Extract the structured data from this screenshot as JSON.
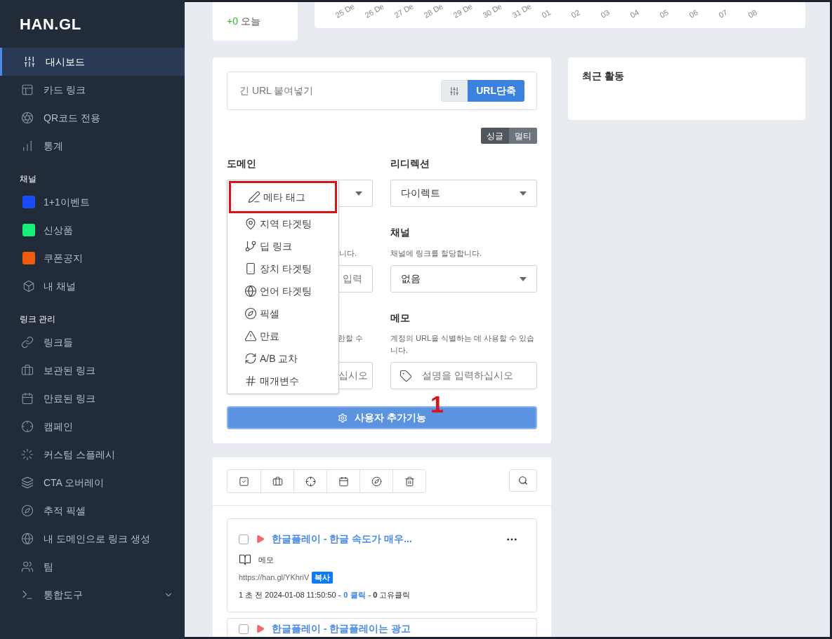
{
  "sidebar": {
    "logo": "HAN.GL",
    "main_items": [
      {
        "label": "대시보드",
        "selected": true
      },
      {
        "label": "카드 링크",
        "selected": false
      },
      {
        "label": "QR코드 전용",
        "selected": false
      },
      {
        "label": "통계",
        "selected": false
      }
    ],
    "channels_title": "채널",
    "channels": [
      {
        "label": "1+1이벤트",
        "kind": "color",
        "color": "#1a4dff"
      },
      {
        "label": "신상품",
        "kind": "color",
        "color": "#14f07a"
      },
      {
        "label": "쿠폰공지",
        "kind": "color",
        "color": "#f25a0f"
      },
      {
        "label": "내 채널",
        "kind": "icon"
      }
    ],
    "links_title": "링크 관리",
    "link_items": [
      {
        "label": "링크들",
        "kind": "plain"
      },
      {
        "label": "보관된 링크",
        "kind": "plain"
      },
      {
        "label": "만료된 링크",
        "kind": "plain"
      },
      {
        "label": "캠페인",
        "kind": "plain"
      },
      {
        "label": "커스텀 스플레시",
        "kind": "plain"
      },
      {
        "label": "CTA 오버레이",
        "kind": "plain"
      },
      {
        "label": "추적 픽셀",
        "kind": "plain"
      },
      {
        "label": "내 도메인으로 링크 생성",
        "kind": "plain"
      },
      {
        "label": "팀",
        "kind": "plain"
      },
      {
        "label": "통합도구",
        "kind": "group",
        "expanded": false
      }
    ]
  },
  "stats_card": {
    "delta": "+0",
    "label": "오늘"
  },
  "chart_axis_labels": [
    "25 De",
    "26 De",
    "27 De",
    "28 De",
    "29 De",
    "30 De",
    "31 De",
    "01",
    "02",
    "03",
    "04",
    "05",
    "06",
    "07",
    "08"
  ],
  "shortener": {
    "url_placeholder": "긴 URL 붙여넣기",
    "shorten_button": "URL단축",
    "modes": [
      {
        "label": "싱글",
        "selected": true
      },
      {
        "label": "멀티",
        "selected": false
      }
    ],
    "domain_label": "도메인",
    "domain_desc_fragment": "니다.",
    "domain_input_fragment": "입력",
    "limit_desc_fragment": "한할 수",
    "limit_input_fragment": "십시오",
    "redirect_label": "리디렉션",
    "redirect_value": "다이렉트",
    "channel_label": "채널",
    "channel_desc": "채널에 링크를 할당합니다.",
    "channel_value": "없음",
    "memo_label": "메모",
    "memo_desc": "계정의 URL을 식별하는 데 사용할 수 있습니다.",
    "memo_placeholder": "설명을 입력하십시오",
    "menu": [
      {
        "label": "메타 태그",
        "annotated": true
      },
      {
        "label": "지역 타겟팅",
        "annotated": false
      },
      {
        "label": "딥 링크",
        "annotated": false
      },
      {
        "label": "장치 타겟팅",
        "annotated": false
      },
      {
        "label": "언어 타겟팅",
        "annotated": false
      },
      {
        "label": "픽셀",
        "annotated": false
      },
      {
        "label": "만료",
        "annotated": false
      },
      {
        "label": "A/B 교차",
        "annotated": false
      },
      {
        "label": "매개변수",
        "annotated": false
      }
    ],
    "addon_button": "사용자 추가기능",
    "annotation_number": "1"
  },
  "recent_activity": {
    "title": "최근 활동"
  },
  "links": {
    "items": [
      {
        "title": "한글플레이 - 한글 속도가 매우...",
        "checked": false,
        "memo": "메모",
        "url": "https://han.gl/YKhriV",
        "copy": "복사",
        "time": "1 초 전 2024-01-08 11:50:50 -",
        "clicks": "0 클릭",
        "unique": "- **0** 고유클릭"
      },
      {
        "title": "한글플레이 - 한글플레이는 광고",
        "checked": false
      }
    ]
  }
}
